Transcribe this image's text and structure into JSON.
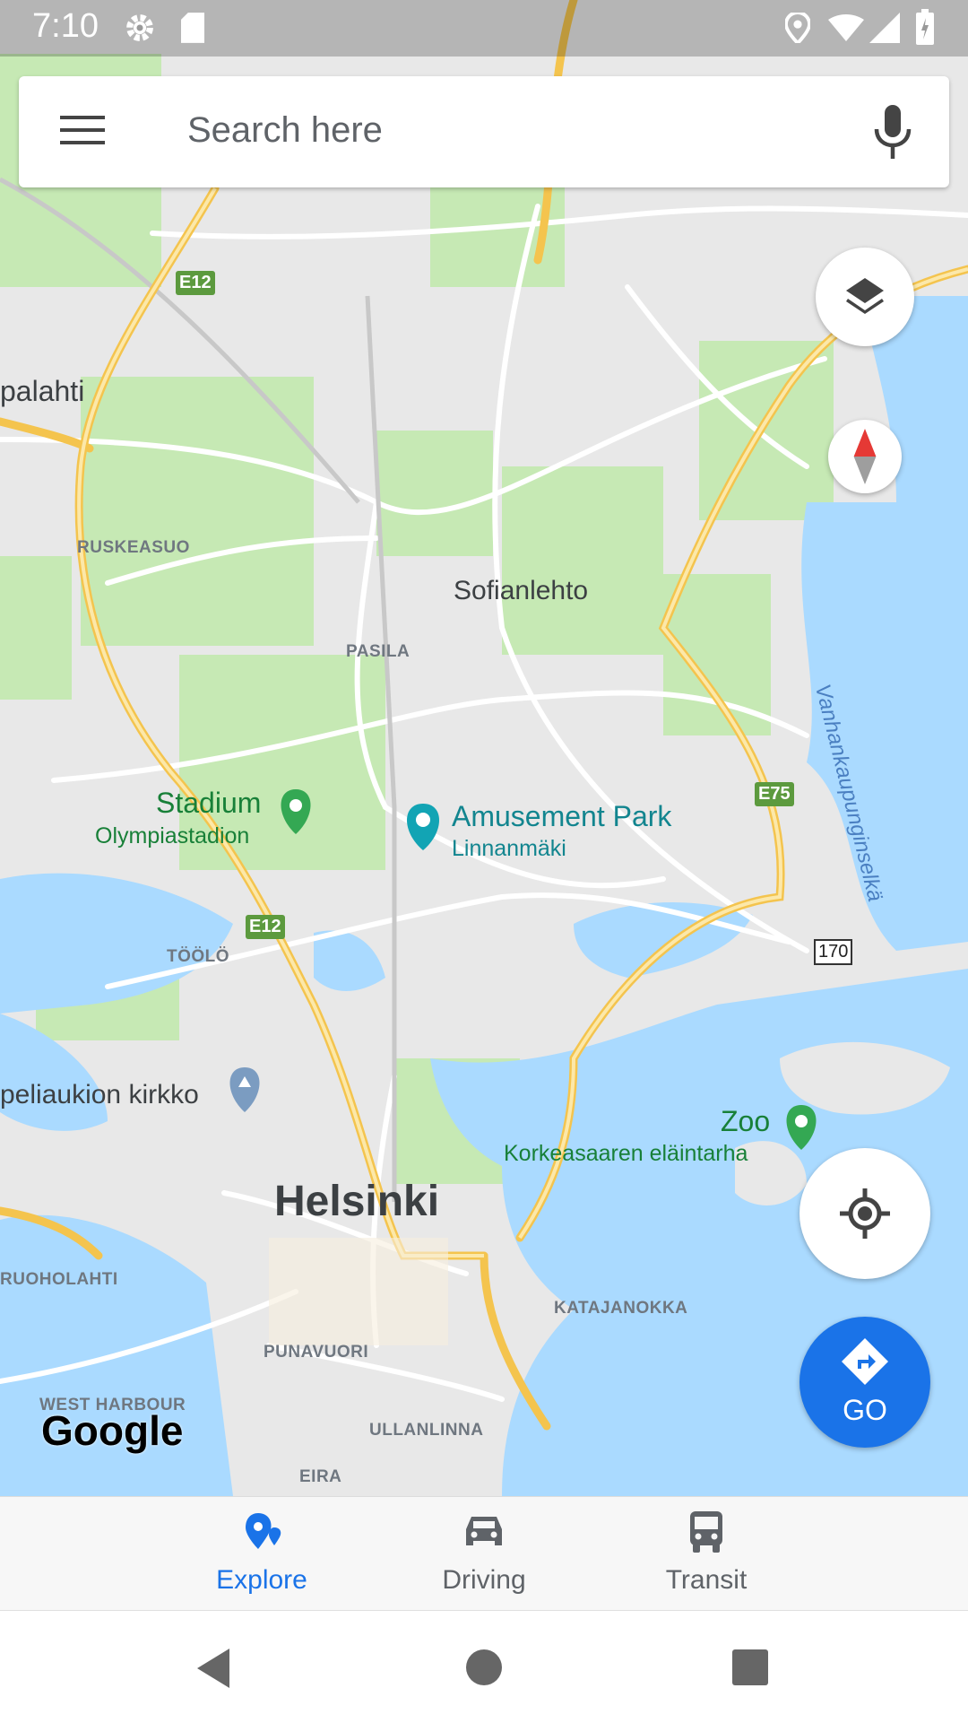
{
  "status_bar": {
    "time": "7:10"
  },
  "search": {
    "placeholder": "Search here"
  },
  "map": {
    "districts": {
      "ruskeasuo": "RUSKEASUO",
      "pasila": "PASILA",
      "toolo": "TÖÖLÖ",
      "ruoholahti": "RUOHOLAHTI",
      "katajanokka": "KATAJANOKKA",
      "punavuori": "PUNAVUORI",
      "west_harbour": "WEST HARBOUR",
      "ullanlinna": "ULLANLINNA",
      "eira": "EIRA"
    },
    "places": {
      "helsinki": "Helsinki",
      "sofianlehto": "Sofianlehto",
      "palahti": "palahti"
    },
    "pois": {
      "stadium": "Stadium",
      "stadium_sub": "Olympiastadion",
      "amusement": "Amusement Park",
      "amusement_sub": "Linnanmäki",
      "zoo": "Zoo",
      "zoo_sub": "Korkeasaaren eläintarha",
      "church": "peliaukion kirkko"
    },
    "water_label": "Vanhankaupunginselkä",
    "shields": {
      "e12_top": "E12",
      "e12_mid": "E12",
      "e75": "E75",
      "r170": "170"
    },
    "logo": "Google"
  },
  "go_button": {
    "label": "GO"
  },
  "bottom_nav": {
    "explore": "Explore",
    "driving": "Driving",
    "transit": "Transit"
  },
  "colors": {
    "accent": "#1a73e8",
    "map_land": "#e8e8e8",
    "map_water": "#aadaff",
    "map_park": "#c6e9b4",
    "highway": "#f9d56b"
  }
}
